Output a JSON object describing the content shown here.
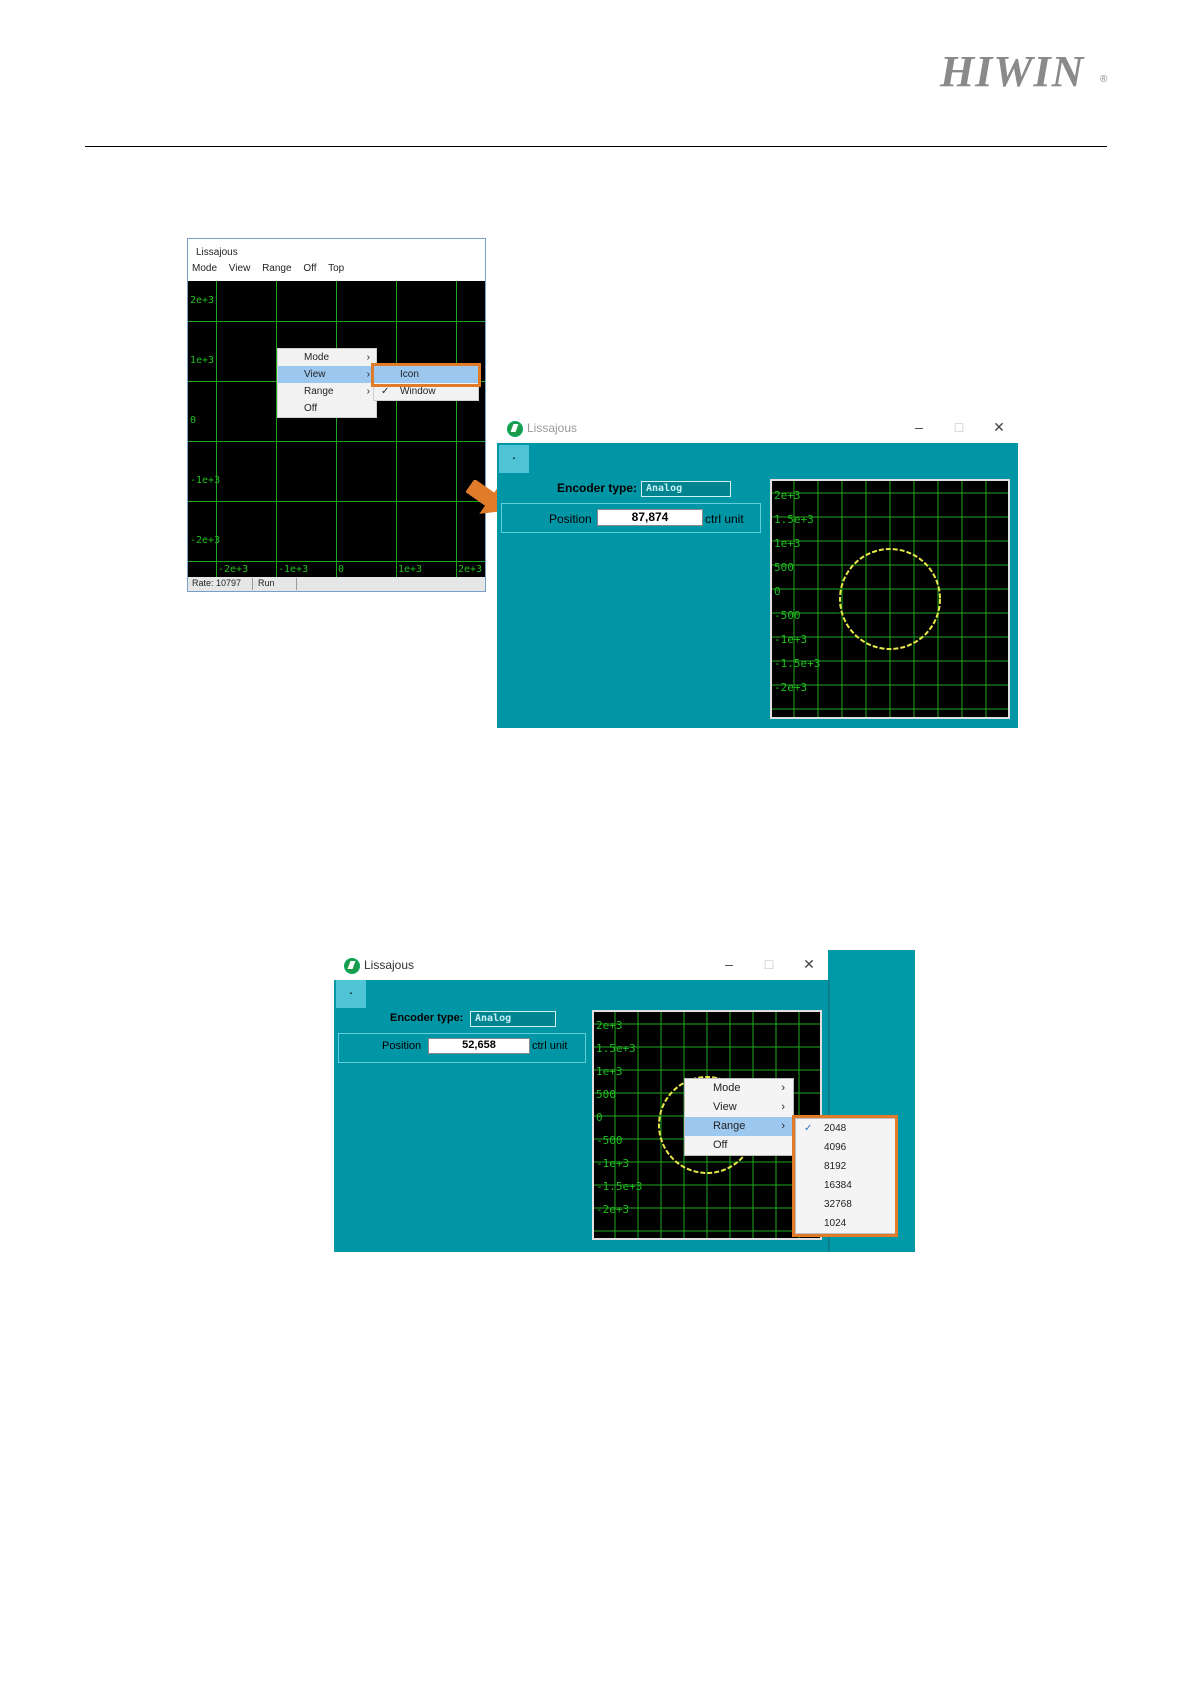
{
  "header": {
    "logo": "HIWIN",
    "registered": "®"
  },
  "screen1": {
    "title": "Lissajous",
    "menu": [
      "Mode",
      "View",
      "Range",
      "Off",
      "Top"
    ],
    "y_labels": [
      "2e+3",
      "1e+3",
      "0",
      "-1e+3",
      "-2e+3"
    ],
    "x_labels": [
      "-2e+3",
      "-1e+3",
      "0",
      "1e+3",
      "2e+3"
    ],
    "context_menu": [
      "Mode",
      "View",
      "Range",
      "Off"
    ],
    "submenu": [
      "Icon",
      "Window"
    ],
    "status": {
      "rate": "Rate: 10797",
      "state": "Run"
    }
  },
  "screen2": {
    "title": "Lissajous",
    "dot_button": "·",
    "encoder_label": "Encoder type:",
    "encoder_value": "Analog",
    "position_label": "Position",
    "position_value": "87,874",
    "unit": "ctrl unit",
    "y_labels": [
      "2e+3",
      "1.5e+3",
      "1e+3",
      "500",
      "0",
      "-500",
      "-1e+3",
      "-1.5e+3",
      "-2e+3"
    ]
  },
  "screen3": {
    "title": "Lissajous",
    "dot_button": "·",
    "encoder_label": "Encoder type:",
    "encoder_value": "Analog",
    "position_label": "Position",
    "position_value": "52,658",
    "unit": "ctrl unit",
    "y_labels": [
      "2e+3",
      "1.5e+3",
      "1e+3",
      "500",
      "0",
      "-500",
      "-1e+3",
      "-1.5e+3",
      "-2e+3"
    ],
    "context_menu": [
      "Mode",
      "View",
      "Range",
      "Off"
    ],
    "range_options": [
      "2048",
      "4096",
      "8192",
      "16384",
      "32768",
      "1024"
    ]
  },
  "colors": {
    "teal": "#0096a6",
    "grid": "#1fa81f",
    "trace": "#e8e84a",
    "highlight": "#e07b2a",
    "menu_select": "#9cc8f0"
  }
}
